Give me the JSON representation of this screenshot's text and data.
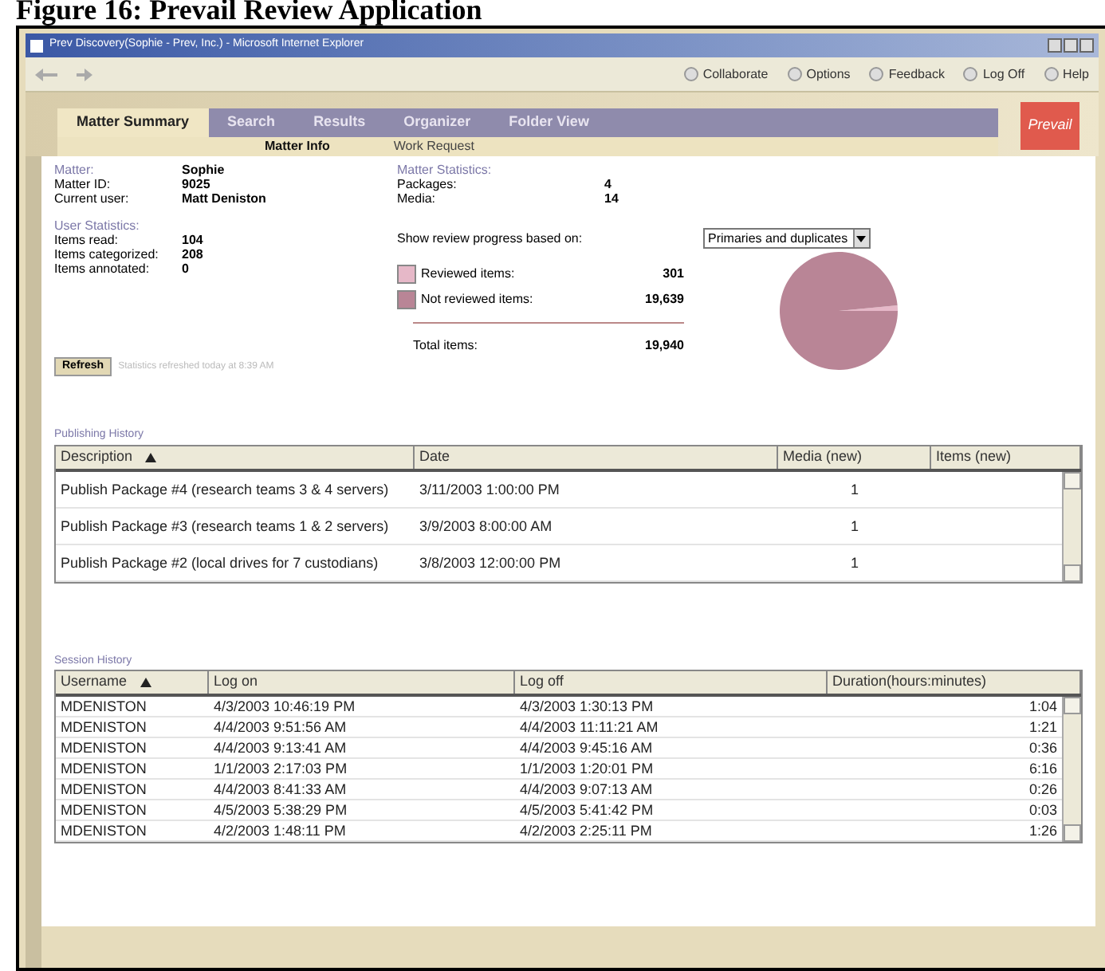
{
  "caption": "Figure 16: Prevail Review Application",
  "window": {
    "title": "Prev Discovery(Sophie - Prev, Inc.) - Microsoft Internet Explorer"
  },
  "toolbar": [
    "Collaborate",
    "Options",
    "Feedback",
    "Log Off",
    "Help"
  ],
  "tabs": [
    {
      "label": "Matter Summary",
      "selected": true
    },
    {
      "label": "Search",
      "selected": false
    },
    {
      "label": "Results",
      "selected": false
    },
    {
      "label": "Organizer",
      "selected": false
    },
    {
      "label": "Folder View",
      "selected": false
    }
  ],
  "logo": "Prevail",
  "subnav": [
    {
      "label": "Matter Info",
      "selected": true
    },
    {
      "label": "Work Request",
      "selected": false
    }
  ],
  "matter": [
    {
      "label": "Matter:",
      "value": "Sophie"
    },
    {
      "label": "Matter ID:",
      "value": "9025"
    },
    {
      "label": "Current user:",
      "value": "Matt Deniston"
    }
  ],
  "matter_statistics": {
    "title": "Matter Statistics:",
    "rows": [
      {
        "label": "Packages:",
        "value": "4"
      },
      {
        "label": "Media:",
        "value": "14"
      }
    ]
  },
  "user_statistics": {
    "title": "User Statistics:",
    "rows": [
      {
        "label": "Items read:",
        "value": "104"
      },
      {
        "label": "Items categorized:",
        "value": "208"
      },
      {
        "label": "Items annotated:",
        "value": "0"
      }
    ]
  },
  "refresh": {
    "button": "Refresh",
    "note": "Statistics refreshed today at 8:39 AM"
  },
  "progress": {
    "label": "Show review progress based on:",
    "select": "Primaries and duplicates",
    "legend": [
      {
        "label": "Reviewed items:",
        "value": "301",
        "color": "#e6b8c8"
      },
      {
        "label": "Not reviewed items:",
        "value": "19,639",
        "color": "#b98596"
      }
    ],
    "total": {
      "label": "Total items:",
      "value": "19,940"
    }
  },
  "publishing_history": {
    "title": "Publishing History",
    "columns": [
      {
        "label": "Description",
        "sorted": true
      },
      {
        "label": "Date",
        "sorted": false
      },
      {
        "label": "Media (new)",
        "sorted": false
      },
      {
        "label": "Items (new)",
        "sorted": false
      }
    ],
    "rows": [
      [
        "Publish Package #4 (research teams 3 & 4 servers)",
        "3/11/2003 1:00:00 PM",
        "1",
        ""
      ],
      [
        "Publish Package #3 (research teams 1 & 2 servers)",
        "3/9/2003 8:00:00 AM",
        "1",
        ""
      ],
      [
        "Publish Package #2 (local drives for 7 custodians)",
        "3/8/2003 12:00:00 PM",
        "1",
        ""
      ]
    ]
  },
  "session_history": {
    "title": "Session History",
    "columns": [
      {
        "label": "Username",
        "sorted": true
      },
      {
        "label": "Log on",
        "sorted": false
      },
      {
        "label": "Log off",
        "sorted": false
      },
      {
        "label": "Duration(hours:minutes)",
        "sorted": false
      }
    ],
    "rows": [
      [
        "MDENISTON",
        "4/3/2003 10:46:19 PM",
        "4/3/2003 1:30:13 PM",
        "1:04"
      ],
      [
        "MDENISTON",
        "4/4/2003 9:51:56 AM",
        "4/4/2003 11:11:21 AM",
        "1:21"
      ],
      [
        "MDENISTON",
        "4/4/2003 9:13:41 AM",
        "4/4/2003 9:45:16 AM",
        "0:36"
      ],
      [
        "MDENISTON",
        "1/1/2003 2:17:03 PM",
        "1/1/2003 1:20:01 PM",
        "6:16"
      ],
      [
        "MDENISTON",
        "4/4/2003 8:41:33 AM",
        "4/4/2003 9:07:13 AM",
        "0:26"
      ],
      [
        "MDENISTON",
        "4/5/2003 5:38:29 PM",
        "4/5/2003 5:41:42 PM",
        "0:03"
      ],
      [
        "MDENISTON",
        "4/2/2003 1:48:11 PM",
        "4/2/2003 2:25:11 PM",
        "1:26"
      ]
    ]
  }
}
